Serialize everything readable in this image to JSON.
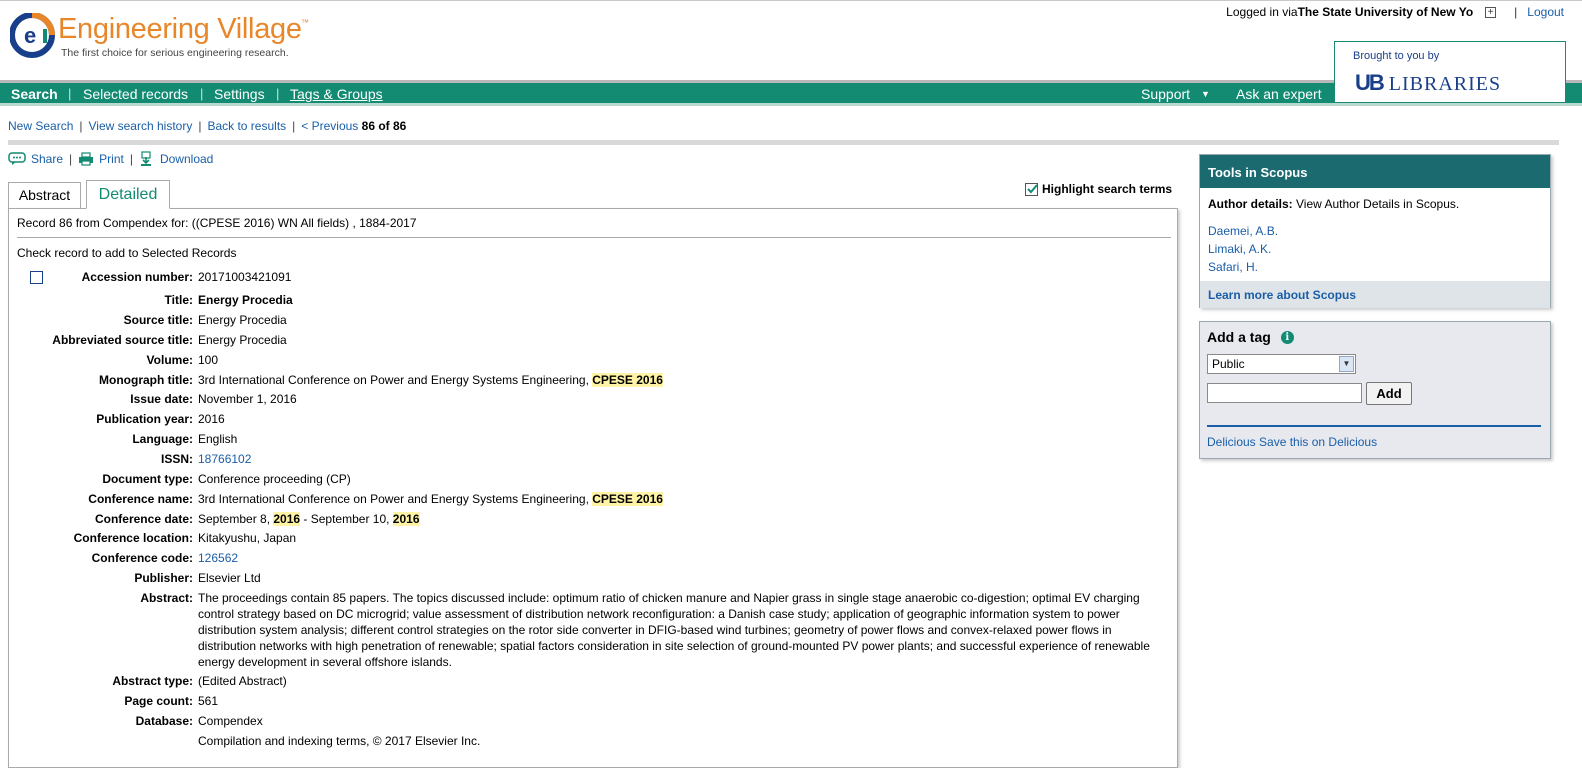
{
  "header": {
    "logo_title": "Engineering Village",
    "logo_tm": "™",
    "logo_tagline": "The first choice for serious engineering research.",
    "login_prefix": "Logged in via ",
    "login_org": "The State University of New Yo",
    "login_expand": "+",
    "login_separator": "|",
    "logout_label": "Logout",
    "brought_label": "Brought to you by",
    "ub_mark": "UB",
    "ub_text": "LIBRARIES"
  },
  "nav": {
    "search": "Search",
    "selected_records": "Selected records",
    "settings": "Settings",
    "tags_groups": "Tags & Groups",
    "support": "Support",
    "support_caret": "▼",
    "ask_expert": "Ask an expert",
    "separator": "|"
  },
  "breadcrumbs": {
    "new_search": "New Search",
    "view_history": "View search history",
    "back_results": "Back to results",
    "previous": "< Previous",
    "position": "86 of 86",
    "separator": "|"
  },
  "toolbar": {
    "share": "Share",
    "print": "Print",
    "download": "Download",
    "separator": "|"
  },
  "tabs": {
    "abstract": "Abstract",
    "detailed": "Detailed"
  },
  "highlight_label": "Highlight search terms",
  "record": {
    "header": "Record 86 from Compendex for: ((CPESE 2016) WN All fields) , 1884-2017",
    "check_note": "Check record to add to Selected Records",
    "fields": {
      "accession": {
        "label": "Accession number:",
        "value": "20171003421091"
      },
      "title": {
        "label": "Title:",
        "value": "Energy Procedia"
      },
      "source_title": {
        "label": "Source title:",
        "value": "Energy Procedia"
      },
      "abbrev_source": {
        "label": "Abbreviated source title:",
        "value": "Energy Procedia"
      },
      "volume": {
        "label": "Volume:",
        "value": "100"
      },
      "monograph": {
        "label": "Monograph title:",
        "value": "3rd International Conference on Power and Energy Systems Engineering, ",
        "hl": "CPESE 2016"
      },
      "issue_date": {
        "label": "Issue date:",
        "value": "November 1, 2016"
      },
      "pub_year": {
        "label": "Publication year:",
        "value": "2016"
      },
      "language": {
        "label": "Language:",
        "value": "English"
      },
      "issn": {
        "label": "ISSN:",
        "value": "18766102"
      },
      "doc_type": {
        "label": "Document type:",
        "value": "Conference proceeding (CP)"
      },
      "conf_name": {
        "label": "Conference name:",
        "value": "3rd International Conference on Power and Energy Systems Engineering, ",
        "hl": "CPESE 2016"
      },
      "conf_date": {
        "label": "Conference date:",
        "part1": "September 8, ",
        "hl1": "2016",
        "part2": " - September 10, ",
        "hl2": "2016"
      },
      "conf_location": {
        "label": "Conference location:",
        "value": "Kitakyushu, Japan"
      },
      "conf_code": {
        "label": "Conference code:",
        "value": "126562"
      },
      "publisher": {
        "label": "Publisher:",
        "value": "Elsevier Ltd"
      },
      "abstract": {
        "label": "Abstract:",
        "value": "The proceedings contain 85 papers. The topics discussed include: optimum ratio of chicken manure and Napier grass in single stage anaerobic co-digestion; optimal EV charging control strategy based on DC microgrid; value assessment of distribution network reconfiguration: a Danish case study; application of geographic information system to power distribution system analysis; different control strategies on the rotor side converter in DFIG-based wind turbines; geometry of power flows and convex-relaxed power flows in distribution networks with high penetration of renewable; spatial factors consideration in site selection of ground-mounted PV power plants; and successful experience of renewable energy development in several offshore islands."
      },
      "abstract_type": {
        "label": "Abstract type:",
        "value": "(Edited Abstract)"
      },
      "page_count": {
        "label": "Page count:",
        "value": "561"
      },
      "database": {
        "label": "Database:",
        "value": "Compendex"
      },
      "compilation": {
        "label": "",
        "value": "Compilation and indexing terms, © 2017 Elsevier Inc."
      }
    }
  },
  "scopus": {
    "title": "Tools in Scopus",
    "author_label": "Author details:",
    "author_text": " View Author Details in Scopus.",
    "authors": [
      "Daemei, A.B.",
      "Limaki, A.K.",
      "Safari, H."
    ],
    "learn_more": "Learn more about Scopus"
  },
  "tag": {
    "title": "Add a tag",
    "info": "i",
    "visibility": "Public",
    "select_arrow": "▼",
    "input_value": "",
    "add_label": "Add",
    "delicious_link": "Delicious",
    "delicious_text": " Save this on Delicious"
  },
  "colors": {
    "brand_orange": "#e8862a",
    "nav_green": "#138a72",
    "link_blue": "#1a5ea8",
    "scopus_teal": "#1b6a70",
    "highlight_yellow": "#fff4a6"
  }
}
